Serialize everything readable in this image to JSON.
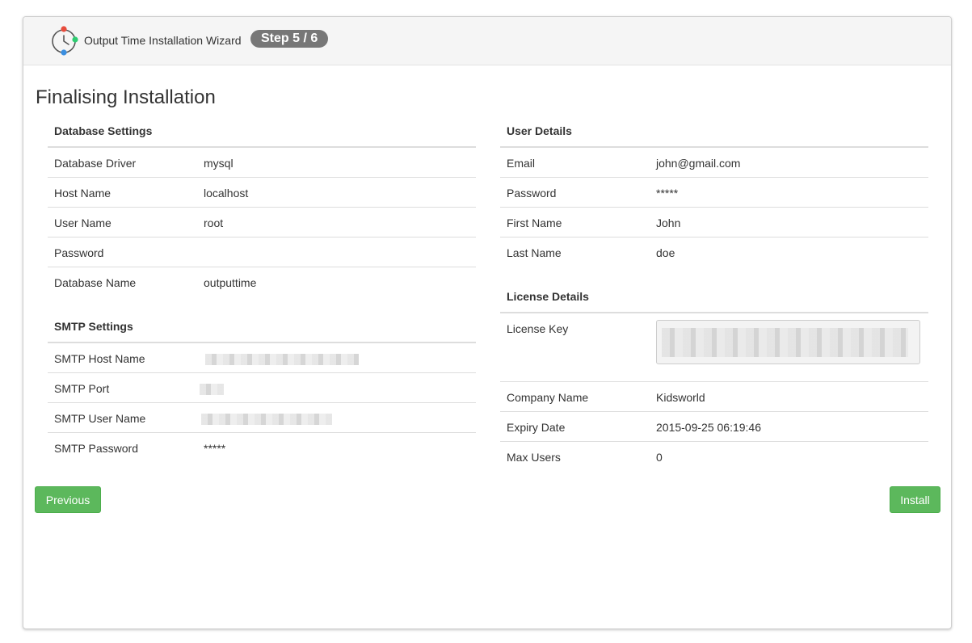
{
  "header": {
    "app_title": "Output Time Installation Wizard",
    "step": "Step 5 / 6",
    "logo_icon": "clock-logo-icon"
  },
  "page_title": "Finalising Installation",
  "database_settings": {
    "heading": "Database Settings",
    "rows": [
      {
        "label": "Database Driver",
        "value": "mysql"
      },
      {
        "label": "Host Name",
        "value": "localhost"
      },
      {
        "label": "User Name",
        "value": "root"
      },
      {
        "label": "Password",
        "value": ""
      },
      {
        "label": "Database Name",
        "value": "outputtime"
      }
    ]
  },
  "smtp_settings": {
    "heading": "SMTP Settings",
    "rows": [
      {
        "label": "SMTP Host Name",
        "value": ""
      },
      {
        "label": "SMTP Port",
        "value": ""
      },
      {
        "label": "SMTP User Name",
        "value": ""
      },
      {
        "label": "SMTP Password",
        "value": "*****"
      }
    ]
  },
  "user_details": {
    "heading": "User Details",
    "rows": [
      {
        "label": "Email",
        "value": "john@gmail.com"
      },
      {
        "label": "Password",
        "value": "*****"
      },
      {
        "label": "First Name",
        "value": "John"
      },
      {
        "label": "Last Name",
        "value": "doe"
      }
    ]
  },
  "license_details": {
    "heading": "License Details",
    "license_key_label": "License Key",
    "rows": [
      {
        "label": "Company Name",
        "value": "Kidsworld"
      },
      {
        "label": "Expiry Date",
        "value": "2015-09-25 06:19:46"
      },
      {
        "label": "Max Users",
        "value": "0"
      }
    ]
  },
  "buttons": {
    "previous": "Previous",
    "install": "Install"
  },
  "colors": {
    "button_green": "#5cb85c",
    "badge_gray": "#777777",
    "header_bg": "#f5f5f5"
  }
}
